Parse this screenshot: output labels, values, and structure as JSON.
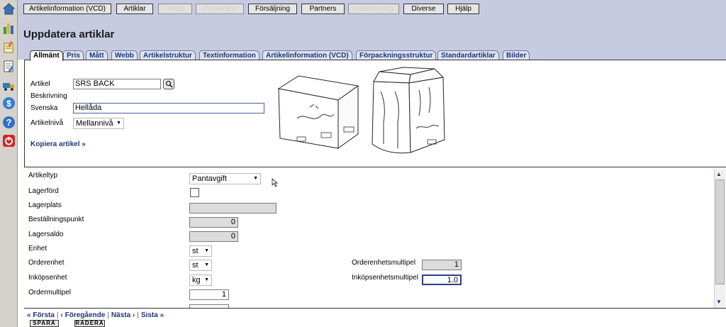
{
  "menu": [
    "Artikelinformation (VCD)",
    "Artiklar",
    "Inköp",
    "Produktion",
    "Försäljning",
    "Partners",
    "Redovisning",
    "Diverse",
    "Hjälp"
  ],
  "page_title": "Uppdatera artiklar",
  "subtabs": [
    "Allmänt",
    "Pris",
    "Mått",
    "Webb",
    "Artikelstruktur",
    "Textinformation",
    "Artikelinformation (VCD)",
    "Förpackningsstruktur",
    "Standardartiklar",
    "Bilder"
  ],
  "upper": {
    "artikel_label": "Artikel",
    "artikel_value": "SRS BACK",
    "beskrivning_label": "Beskrivning",
    "svenska_label": "Svenska",
    "svenska_value": "Hellåda",
    "niva_label": "Artikelnivå",
    "niva_value": "Mellannivå",
    "kopiera": "Kopiera artikel »"
  },
  "lower": {
    "artikeltyp_label": "Artikeltyp",
    "artikeltyp_value": "Pantavgift",
    "lagerford_label": "Lagerförd",
    "lagerplats_label": "Lagerplats",
    "bestallningspunkt_label": "Beställningspunkt",
    "bestallningspunkt_value": "0",
    "lagersaldo_label": "Lagersaldo",
    "lagersaldo_value": "0",
    "enhet_label": "Enhet",
    "enhet_value": "st",
    "orderenhet_label": "Orderenhet",
    "orderenhet_value": "st",
    "inkopsenhet_label": "Inköpsenhet",
    "inkopsenhet_value": "kg",
    "ordermultipel_label": "Ordermultipel",
    "ordermultipel_value": "1",
    "orderenhetsmultipel_label": "Orderenhetsmultipel",
    "orderenhetsmultipel_value": "1",
    "inkopsenhetsmultipel_label": "Inköpsenhetsmultipel",
    "inkopsenhetsmultipel_value": "1.0"
  },
  "pager": {
    "forsta": "« Första",
    "foregaende": "‹ Föregående",
    "nasta": "Nästa ›",
    "sista": "Sista »"
  },
  "buttons": {
    "spara": "SPARA",
    "radera": "RADERA"
  },
  "colors": {
    "topband": "#c6cbe2",
    "link": "#1f3577"
  }
}
